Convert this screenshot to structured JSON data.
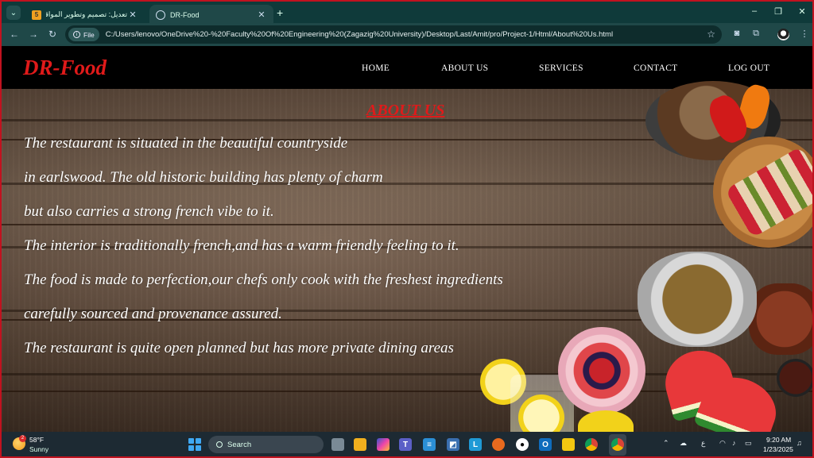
{
  "browser": {
    "tabs": [
      {
        "title": "تعديل: تصميم وتطوير المواقع بـ...",
        "favicon": "5",
        "active": false
      },
      {
        "title": "DR-Food",
        "active": true
      }
    ],
    "new_tab": "+",
    "address": {
      "protocol_chip": "File",
      "url": "C:/Users/lenovo/OneDrive%20-%20Faculty%20Of%20Engineering%20(Zagazig%20University)/Desktop/Last/Amit/pro/Project-1/Html/About%20Us.html"
    },
    "window_controls": [
      "–",
      "❐",
      "✕"
    ]
  },
  "site": {
    "logo": "DR-Food",
    "nav": [
      "HOME",
      "ABOUT US",
      "SERVICES",
      "CONTACT",
      "LOG OUT"
    ],
    "heading": "ABOUT US",
    "paragraph_lines": [
      "The restaurant is situated in the beautiful countryside",
      "in earlswood. The old historic building has plenty of charm",
      "but also carries a strong french vibe to it.",
      "The interior is traditionally french,and has a warm friendly feeling to it.",
      "The food is made to perfection,our chefs only cook with the freshest ingredients",
      "carefully sourced and provenance assured.",
      "The restaurant is quite open planned but has more private dining areas"
    ],
    "colors": {
      "accent": "#e01a1a",
      "nav_bg": "#000000",
      "text": "#ffffff"
    }
  },
  "taskbar": {
    "weather": {
      "temp": "58°F",
      "desc": "Sunny",
      "badge": "2"
    },
    "search_placeholder": "Search",
    "clock": {
      "time": "9:20 AM",
      "date": "1/23/2025"
    },
    "tray_lang": "ع",
    "apps": [
      "file-explorer-icon",
      "folder-icon",
      "copilot-icon",
      "teams-icon",
      "notepad-icon",
      "code-icon",
      "l-app-icon",
      "firefox-icon",
      "github-icon",
      "outlook-icon",
      "powerbi-icon",
      "chrome-icon",
      "chrome-active-icon"
    ]
  }
}
